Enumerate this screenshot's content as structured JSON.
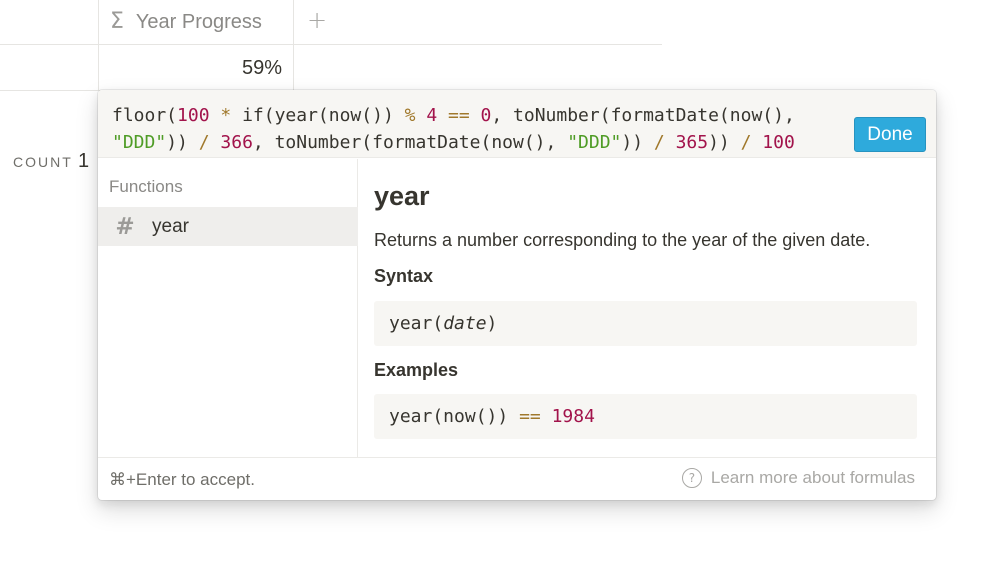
{
  "table": {
    "column_header": "Year Progress",
    "column_icon": "sigma-icon",
    "add_column_icon": "plus-icon",
    "cell_value": "59%",
    "count_label": "COUNT",
    "count_value": "1"
  },
  "formula_editor": {
    "tokens": [
      {
        "t": "floor(",
        "k": "fn"
      },
      {
        "t": "100",
        "k": "num"
      },
      {
        "t": " * ",
        "k": "op"
      },
      {
        "t": "if(year(now()) ",
        "k": "fn"
      },
      {
        "t": "%",
        "k": "op"
      },
      {
        "t": " ",
        "k": "fn"
      },
      {
        "t": "4",
        "k": "num"
      },
      {
        "t": " == ",
        "k": "op"
      },
      {
        "t": "0",
        "k": "num"
      },
      {
        "t": ", toNumber(formatDate(now(),\n",
        "k": "fn"
      },
      {
        "t": "\"DDD\"",
        "k": "str"
      },
      {
        "t": ")) ",
        "k": "fn"
      },
      {
        "t": "/",
        "k": "op"
      },
      {
        "t": " ",
        "k": "fn"
      },
      {
        "t": "366",
        "k": "num"
      },
      {
        "t": ", toNumber(formatDate(now(), ",
        "k": "fn"
      },
      {
        "t": "\"DDD\"",
        "k": "str"
      },
      {
        "t": ")) ",
        "k": "fn"
      },
      {
        "t": "/",
        "k": "op"
      },
      {
        "t": " ",
        "k": "fn"
      },
      {
        "t": "365",
        "k": "num"
      },
      {
        "t": ")) ",
        "k": "fn"
      },
      {
        "t": "/",
        "k": "op"
      },
      {
        "t": " ",
        "k": "fn"
      },
      {
        "t": "100",
        "k": "num"
      }
    ],
    "done_label": "Done"
  },
  "functions_panel": {
    "header": "Functions",
    "items": [
      {
        "icon": "hash-icon",
        "label": "year",
        "selected": true
      }
    ]
  },
  "doc": {
    "title": "year",
    "description": "Returns a number corresponding to the year of the given date.",
    "syntax_heading": "Syntax",
    "syntax_fn": "year(",
    "syntax_arg": "date",
    "syntax_close": ")",
    "examples_heading": "Examples",
    "example_code": "year(now())",
    "example_op": "==",
    "example_value": "1984"
  },
  "footer": {
    "hint": "⌘+Enter to accept.",
    "help_icon": "question-circle-icon",
    "learn_more": "Learn more about formulas"
  },
  "colors": {
    "accent": "#2eaadc",
    "number_token": "#a2134b",
    "operator_token": "#a0782b",
    "string_token": "#4f9c26"
  }
}
